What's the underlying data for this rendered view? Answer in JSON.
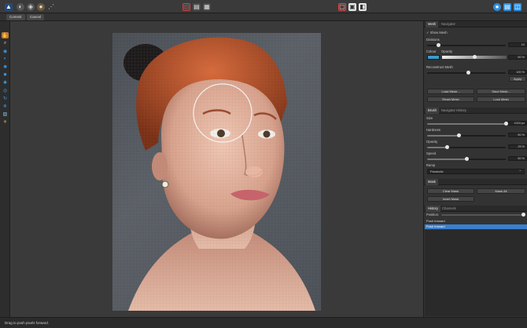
{
  "toolbar": {
    "personas": [
      "affinity-logo-icon",
      "liquify-persona-icon",
      "develop-persona-icon",
      "tone-mapping-persona-icon",
      "export-persona-icon"
    ],
    "center_views": [
      "view-mode-1-icon",
      "view-mode-2-icon",
      "view-mode-3-icon"
    ],
    "right_icons": [
      "mask-view-icon",
      "quickmask-icon",
      "mirror-icon"
    ],
    "far_right_icons": [
      "assistant-icon",
      "arrange-icon",
      "studio-icon"
    ],
    "accent": "#2f8fe0",
    "alert": "#d64a4a"
  },
  "subbar": {
    "commit_label": "Commit",
    "cancel_label": "Cancel"
  },
  "left_tools": [
    "push-forward-tool-icon",
    "zoom-tool-icon",
    "push-left-tool-icon",
    "twirl-tool-icon",
    "pinch-tool-icon",
    "punch-tool-icon",
    "turbulence-tool-icon",
    "clone-tool-icon",
    "reconstruct-tool-icon",
    "freeze-tool-icon",
    "thaw-tool-icon",
    "hand-tool-icon"
  ],
  "panel": {
    "mesh_tabs": [
      "Mesh",
      "Navigator"
    ],
    "show_mesh_label": "Show Mesh",
    "divisions_label": "Divisions",
    "divisions_value": "10",
    "colour_label": "Colour",
    "opacity_label": "Opacity",
    "opacity_value": "50 %",
    "reconstruct_label": "Reconstruct Mesh",
    "reconstruct_value": "100 %",
    "apply_label": "Apply",
    "load_mesh": "Load Mesh...",
    "save_mesh": "Save Mesh...",
    "reset_mesh": "Reset Mesh",
    "lock_mesh": "Lock Mesh",
    "brush_tabs": [
      "Brush",
      "Navigator",
      "History"
    ],
    "size_label": "Size",
    "size_value": "1024 px",
    "hardness_label": "Hardness",
    "hardness_value": "50 %",
    "opacity2_label": "Opacity",
    "opacity2_value": "25 %",
    "speed_label": "Speed",
    "speed_value": "50 %",
    "ramp_label": "Ramp",
    "ramp_value": "Parabolic",
    "mask_header": "Mask",
    "clear_mask": "Clear Mask",
    "mask_all": "Mask All",
    "invert_mask": "Invert Mask",
    "history_tabs": [
      "History",
      "Channels"
    ],
    "position_label": "Position:",
    "history_items": [
      "Push forward",
      "Push forward"
    ]
  },
  "status": {
    "text": "Drag to push pixels forward."
  }
}
